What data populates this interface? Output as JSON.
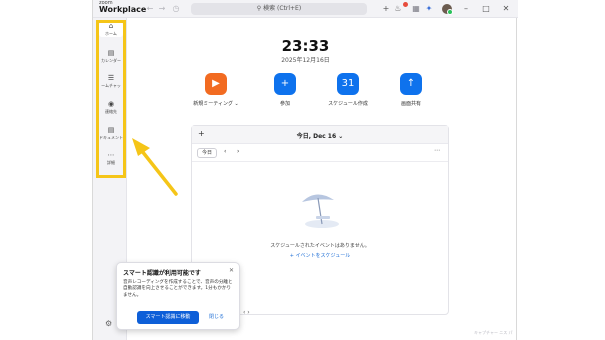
{
  "titlebar": {
    "logo_top": "zoom",
    "logo_bottom": "Workplace",
    "search_placeholder": "検索 (Ctrl+E)"
  },
  "sidebar": {
    "items": [
      {
        "icon": "home-icon",
        "label": "ホーム"
      },
      {
        "icon": "calendar-icon",
        "label": "カレンダー"
      },
      {
        "icon": "team-chat-icon",
        "label": "ームチャッ"
      },
      {
        "icon": "contacts-icon",
        "label": "連絡先"
      },
      {
        "icon": "document-icon",
        "label": "ドキュメント"
      },
      {
        "icon": "more-icon",
        "label": "詳細"
      }
    ],
    "highlight_color": "#f5c518"
  },
  "main": {
    "time": "23:33",
    "date": "2025年12月16日",
    "actions": [
      {
        "icon": "video-camera-icon",
        "label": "新規ミーティング",
        "color": "#f26b21",
        "has_dropdown": true
      },
      {
        "icon": "plus-icon",
        "label": "参加",
        "color": "#0e72ed"
      },
      {
        "icon": "calendar-schedule-icon",
        "label": "スケジュール作成",
        "color": "#0e72ed"
      },
      {
        "icon": "share-screen-icon",
        "label": "画面共有",
        "color": "#0e72ed"
      }
    ]
  },
  "calendar_card": {
    "add_icon": "plus-icon",
    "title": "今日, Dec 16",
    "today_button": "今日",
    "empty_message": "スケジュールされたイベントはありません。",
    "schedule_link": "+ イベントをスケジュール"
  },
  "popup": {
    "title": "スマート認識が利用可能です",
    "body": "音声レコーディングを作成することで、音声の分離と自動認識を向上させることができます。1分もかかりません。",
    "primary_button": "スマート認識に移動",
    "secondary_button": "閉じる"
  },
  "watermark": "キャプチャー ニス パ"
}
